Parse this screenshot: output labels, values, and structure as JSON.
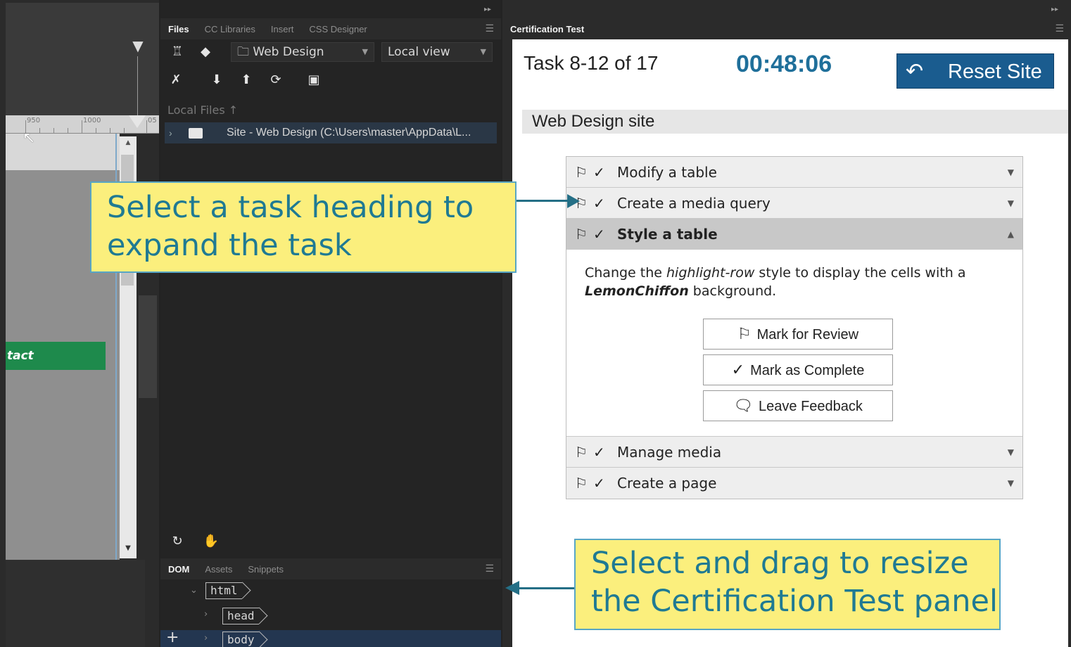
{
  "files_panel": {
    "tabs": [
      "Files",
      "CC Libraries",
      "Insert",
      "CSS Designer"
    ],
    "site_dropdown": "Web Design",
    "view_dropdown": "Local view",
    "local_files_label": "Local Files",
    "site_row": "Site - Web Design (C:\\Users\\master\\AppData\\L...",
    "dom_tabs": [
      "DOM",
      "Assets",
      "Snippets"
    ],
    "dom_nodes": [
      "html",
      "head",
      "body"
    ]
  },
  "design_view": {
    "ruler_labels": [
      "950",
      "1000",
      "05"
    ],
    "nav_text": "tact"
  },
  "cert_panel": {
    "tab": "Certification Test",
    "task_count": "Task 8-12 of 17",
    "timer": "00:48:06",
    "reset_label": "Reset Site",
    "site_title": "Web Design site",
    "tasks": [
      {
        "label": "Modify a table"
      },
      {
        "label": "Create a media query"
      },
      {
        "label": "Style a table"
      },
      {
        "label": "Manage media"
      },
      {
        "label": "Create a page"
      }
    ],
    "description": {
      "part1": "Change the ",
      "em1": "highlight-row",
      "part2": " style to display the cells with a ",
      "em2": "LemonChiffon",
      "part3": " background."
    },
    "actions": [
      "Mark for Review",
      "Mark as Complete",
      "Leave Feedback"
    ]
  },
  "callouts": {
    "heading_tip": "Select a task heading to expand the task",
    "resize_tip": "Select and drag to resize the Certification Test panel"
  },
  "colors": {
    "accent": "#1a5c8f",
    "timer": "#1f6f9a",
    "callout_bg": "#fbef7d",
    "callout_text": "#1f7a93",
    "nav_green": "#1e8a4c"
  }
}
